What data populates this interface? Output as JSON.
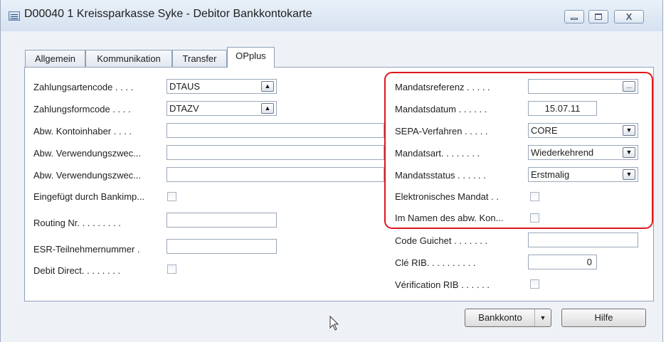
{
  "window": {
    "title": "D00040 1 Kreissparkasse Syke - Debitor Bankkontokarte",
    "close_glyph": "X"
  },
  "tabs": [
    "Allgemein",
    "Kommunikation",
    "Transfer",
    "OPplus"
  ],
  "left_fields": {
    "zahlungsartencode": {
      "label": "Zahlungsartencode . . . .",
      "value": "DTAUS"
    },
    "zahlungsformcode": {
      "label": "Zahlungsformcode . . . .",
      "value": "DTAZV"
    },
    "abw_kontoinhaber": {
      "label": "Abw. Kontoinhaber . . . .",
      "value": ""
    },
    "abw_verwendungszweck1": {
      "label": "Abw. Verwendungszwec...",
      "value": ""
    },
    "abw_verwendungszweck2": {
      "label": "Abw. Verwendungszwec...",
      "value": ""
    },
    "eingefuegt_durch_bankimp": {
      "label": "Eingefügt durch Bankimp..."
    },
    "routing_nr": {
      "label": "Routing Nr. . . . . . . . .",
      "value": ""
    },
    "esr_teilnehmernummer": {
      "label": "ESR-Teilnehmernummer .",
      "value": ""
    },
    "debit_direct": {
      "label": "Debit Direct. . . . . . . ."
    }
  },
  "right_fields": {
    "mandatsreferenz": {
      "label": "Mandatsreferenz . . . . .",
      "value": "",
      "button": "..."
    },
    "mandatsdatum": {
      "label": "Mandatsdatum . . . . . .",
      "value": "15.07.11"
    },
    "sepa_verfahren": {
      "label": "SEPA-Verfahren . . . . .",
      "value": "CORE"
    },
    "mandatsart": {
      "label": "Mandatsart. . . . . . . .",
      "value": "Wiederkehrend"
    },
    "mandatsstatus": {
      "label": "Mandatsstatus . . . . . .",
      "value": "Erstmalig"
    },
    "elektronisches_mandat": {
      "label": "Elektronisches Mandat . ."
    },
    "im_namen": {
      "label": "Im Namen des abw. Kon..."
    },
    "code_guichet": {
      "label": "Code Guichet . . . . . . .",
      "value": ""
    },
    "cle_rib": {
      "label": "Clé RIB. . . . . . . . . .",
      "value": "0"
    },
    "verification_rib": {
      "label": "Vérification RIB . . . . . ."
    }
  },
  "icons": {
    "lookup_up": "▲",
    "dropdown": "▼"
  },
  "buttons": {
    "bankkonto": "Bankkonto",
    "hilfe": "Hilfe"
  },
  "colors": {
    "highlight_border": "#e0161b",
    "titlebar": "#dbe6f3"
  }
}
